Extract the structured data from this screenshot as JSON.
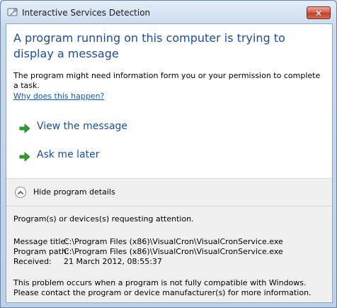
{
  "window": {
    "title": "Interactive Services Detection",
    "close_symbol": "✕"
  },
  "content": {
    "headline": "A program running on this computer is trying to display a message",
    "description": "The program might need information form you or your permission to complete a task.",
    "help_link": "Why does this happen?"
  },
  "commands": [
    {
      "label": "View the message",
      "icon": "green-arrow-icon"
    },
    {
      "label": "Ask me later",
      "icon": "green-arrow-icon"
    }
  ],
  "details": {
    "toggle_label": "Hide program details",
    "requesting": "Program(s) or devices(s) requesting attention.",
    "rows": [
      {
        "key": "Message title:",
        "value": "C:\\Program Files (x86)\\VisualCron\\VisualCronService.exe"
      },
      {
        "key": "Program path:",
        "value": "C:\\Program Files (x86)\\VisualCron\\VisualCronService.exe"
      },
      {
        "key": "Received:",
        "value": "21 March 2012, 08:55:37"
      }
    ],
    "note_line1": "This problem occurs when a program is not fully compatible with Windows.",
    "note_line2": "Please contact the program or device manufacturer(s) for more information."
  },
  "colors": {
    "headline": "#1b4e96",
    "link": "#0b58c6",
    "arrow": "#2aa12a",
    "close_button": "#c13f2a"
  }
}
